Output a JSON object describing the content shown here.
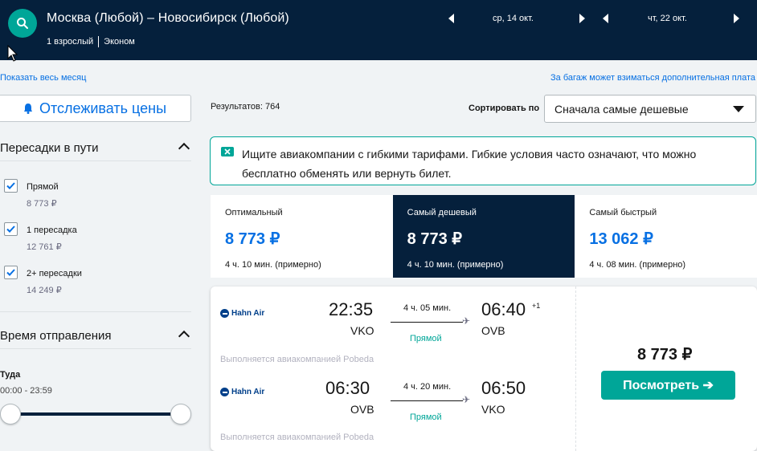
{
  "header": {
    "route": "Москва (Любой) – Новосибирск (Любой)",
    "passengers": "1 взрослый",
    "cabin": "Эконом",
    "depart_date": "ср, 14 окт.",
    "return_date": "чт, 22 окт."
  },
  "links": {
    "show_month": "Показать весь месяц",
    "baggage_fee": "За багаж может взиматься дополнительная плата"
  },
  "sidebar": {
    "track_prices": "Отслеживать цены",
    "stops_title": "Пересадки в пути",
    "stops": [
      {
        "label": "Прямой",
        "price": "8 773 ₽"
      },
      {
        "label": "1 пересадка",
        "price": "12 761 ₽"
      },
      {
        "label": "2+ пересадки",
        "price": "14 249 ₽"
      }
    ],
    "departure_title": "Время отправления",
    "direction": "Туда",
    "time_range": "00:00 - 23:59"
  },
  "results": {
    "count_label": "Результатов: 764",
    "sort_label": "Сортировать по",
    "sort_value": "Сначала самые дешевые"
  },
  "info": {
    "text": "Ищите авиакомпании с гибкими тарифами. Гибкие условия часто означают, что можно бесплатно обменять или вернуть билет."
  },
  "tabs": [
    {
      "title": "Оптимальный",
      "price": "8 773 ₽",
      "duration": "4 ч. 10 мин. (примерно)"
    },
    {
      "title": "Самый дешевый",
      "price": "8 773 ₽",
      "duration": "4 ч. 10 мин. (примерно)"
    },
    {
      "title": "Самый быстрый",
      "price": "13 062 ₽",
      "duration": "4 ч. 08 мин. (примерно)"
    }
  ],
  "card": {
    "airline": "Hahn Air",
    "outbound": {
      "dep_time": "22:35",
      "dep_code": "VKO",
      "arr_time": "06:40",
      "arr_plus": "+1",
      "arr_code": "OVB",
      "duration": "4 ч. 05 мин.",
      "stops": "Прямой",
      "operated": "Выполняется авиакомпанией Pobeda"
    },
    "inbound": {
      "dep_time": "06:30",
      "dep_code": "OVB",
      "arr_time": "06:50",
      "arr_code": "VKO",
      "duration": "4 ч. 20 мин.",
      "stops": "Прямой",
      "operated": "Выполняется авиакомпанией Pobeda"
    },
    "price": "8 773 ₽",
    "button": "Посмотреть ➔"
  },
  "colors": {
    "header_bg": "#05203c",
    "accent_teal": "#00a698",
    "link_blue": "#0770e3"
  }
}
